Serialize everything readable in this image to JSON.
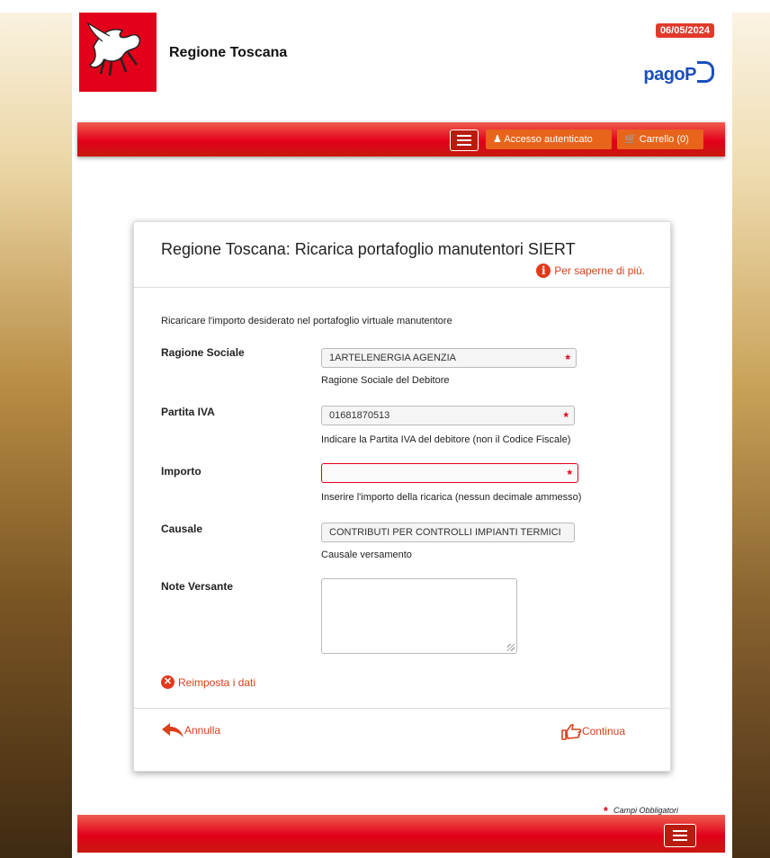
{
  "header": {
    "brand": "Regione Toscana",
    "date": "06/05/2024",
    "pagopa_text": "pagoP"
  },
  "nav": {
    "login_label": "Accesso autenticato",
    "cart_label": "Carrello (0)"
  },
  "card": {
    "title": "Regione Toscana: Ricarica portafoglio manutentori SIERT",
    "info_link": "Per saperne di più.",
    "intro": "Ricaricare l'importo desiderato nel portafoglio virtuale manutentore"
  },
  "form": {
    "ragione_sociale": {
      "label": "Ragione Sociale",
      "value": "1ARTELENERGIA AGENZIA",
      "help": "Ragione Sociale del Debitore"
    },
    "partita_iva": {
      "label": "Partita IVA",
      "value": "01681870513",
      "help": "Indicare la Partita IVA del debitore (non il Codice Fiscale)"
    },
    "importo": {
      "label": "Importo",
      "value": "",
      "help": "Inserire l'importo della ricarica (nessun decimale ammesso)"
    },
    "causale": {
      "label": "Causale",
      "value": "CONTRIBUTI PER CONTROLLI IMPIANTI TERMICI",
      "help": "Causale versamento"
    },
    "note": {
      "label": "Note Versante",
      "value": ""
    },
    "required_mark": "*"
  },
  "actions": {
    "reset": "Reimposta i dati",
    "cancel": "Annulla",
    "continue": "Continua"
  },
  "footer": {
    "required_note": "Campi Obbligatori"
  },
  "colors": {
    "brand_red": "#e2001a",
    "accent_orange": "#e8641b",
    "link_red": "#d9401b",
    "pagopa_blue": "#1a4fbd"
  }
}
